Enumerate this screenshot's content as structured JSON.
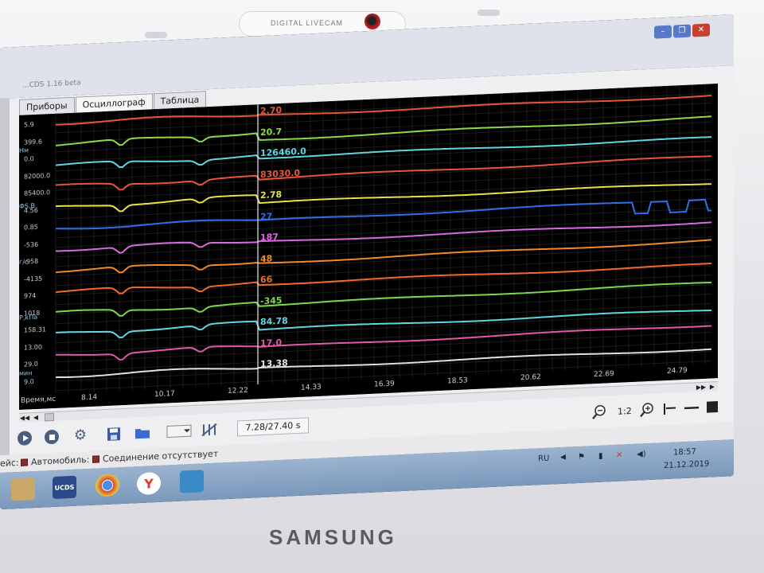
{
  "camera": {
    "label": "DIGITAL LIVECAM"
  },
  "brand": "SAMSUNG",
  "window": {
    "title": "...CDS 1.16 beta",
    "buttons": [
      "minimize",
      "restore",
      "close"
    ]
  },
  "tabs": [
    {
      "label": "Приборы",
      "active": false
    },
    {
      "label": "Осциллограф",
      "active": true
    },
    {
      "label": "Таблица",
      "active": false
    }
  ],
  "scope": {
    "time_axis_label": "Время,мс",
    "time_ticks": [
      "8.14",
      "10.17",
      "12.22",
      "14.33",
      "16.39",
      "18.53",
      "20.62",
      "22.69",
      "24.79"
    ],
    "cursor_time_ms": 13.38,
    "y_scale_labels": [
      "5.9",
      "399.6",
      "0.0",
      "82000.0",
      "85400.0",
      "4.56",
      "0.85",
      "-536",
      "-958",
      "-4135",
      "974",
      "1018",
      "158.31",
      "13.00",
      "29.0",
      "9.0"
    ],
    "axis_unit_labels": [
      "Нм",
      "ФS,В",
      "г/с",
      "Р,кПа",
      "мин"
    ],
    "channels": [
      {
        "name": "ch1",
        "color": "#e8553a",
        "value": "2.70"
      },
      {
        "name": "ch2",
        "color": "#8ed84a",
        "value": "20.7"
      },
      {
        "name": "ch3",
        "color": "#5fd6e0",
        "value": "126460.0"
      },
      {
        "name": "ch4",
        "color": "#e8553a",
        "value": "83030.0"
      },
      {
        "name": "ch5",
        "color": "#e8e24a",
        "value": "2.78"
      },
      {
        "name": "ch6",
        "color": "#2f6fe8",
        "value": "27"
      },
      {
        "name": "ch7",
        "color": "#d86ae0",
        "value": "187"
      },
      {
        "name": "ch8",
        "color": "#f08a2a",
        "value": "48"
      },
      {
        "name": "ch9",
        "color": "#f06a2a",
        "value": "66"
      },
      {
        "name": "ch10",
        "color": "#7cd84a",
        "value": "-345"
      },
      {
        "name": "ch11",
        "color": "#5fd6e0",
        "value": "84.78"
      },
      {
        "name": "ch12",
        "color": "#e05aa8",
        "value": "17.0"
      },
      {
        "name": "ch13",
        "color": "#e0e0e0",
        "value": "13.38"
      }
    ]
  },
  "toolbar": {
    "time_position": "7.28/27.40 s",
    "zoom_ratio": "1:2"
  },
  "status": {
    "prefix": "ейс:",
    "car": "Автомобиль:",
    "connection": "Соединение отсутствует"
  },
  "taskbar": {
    "apps": [
      "file-manager",
      "UCDS",
      "Chrome",
      "Yandex",
      "messenger"
    ],
    "ucds_label": "UCDS",
    "lang": "RU",
    "time": "18:57",
    "date": "21.12.2019"
  }
}
